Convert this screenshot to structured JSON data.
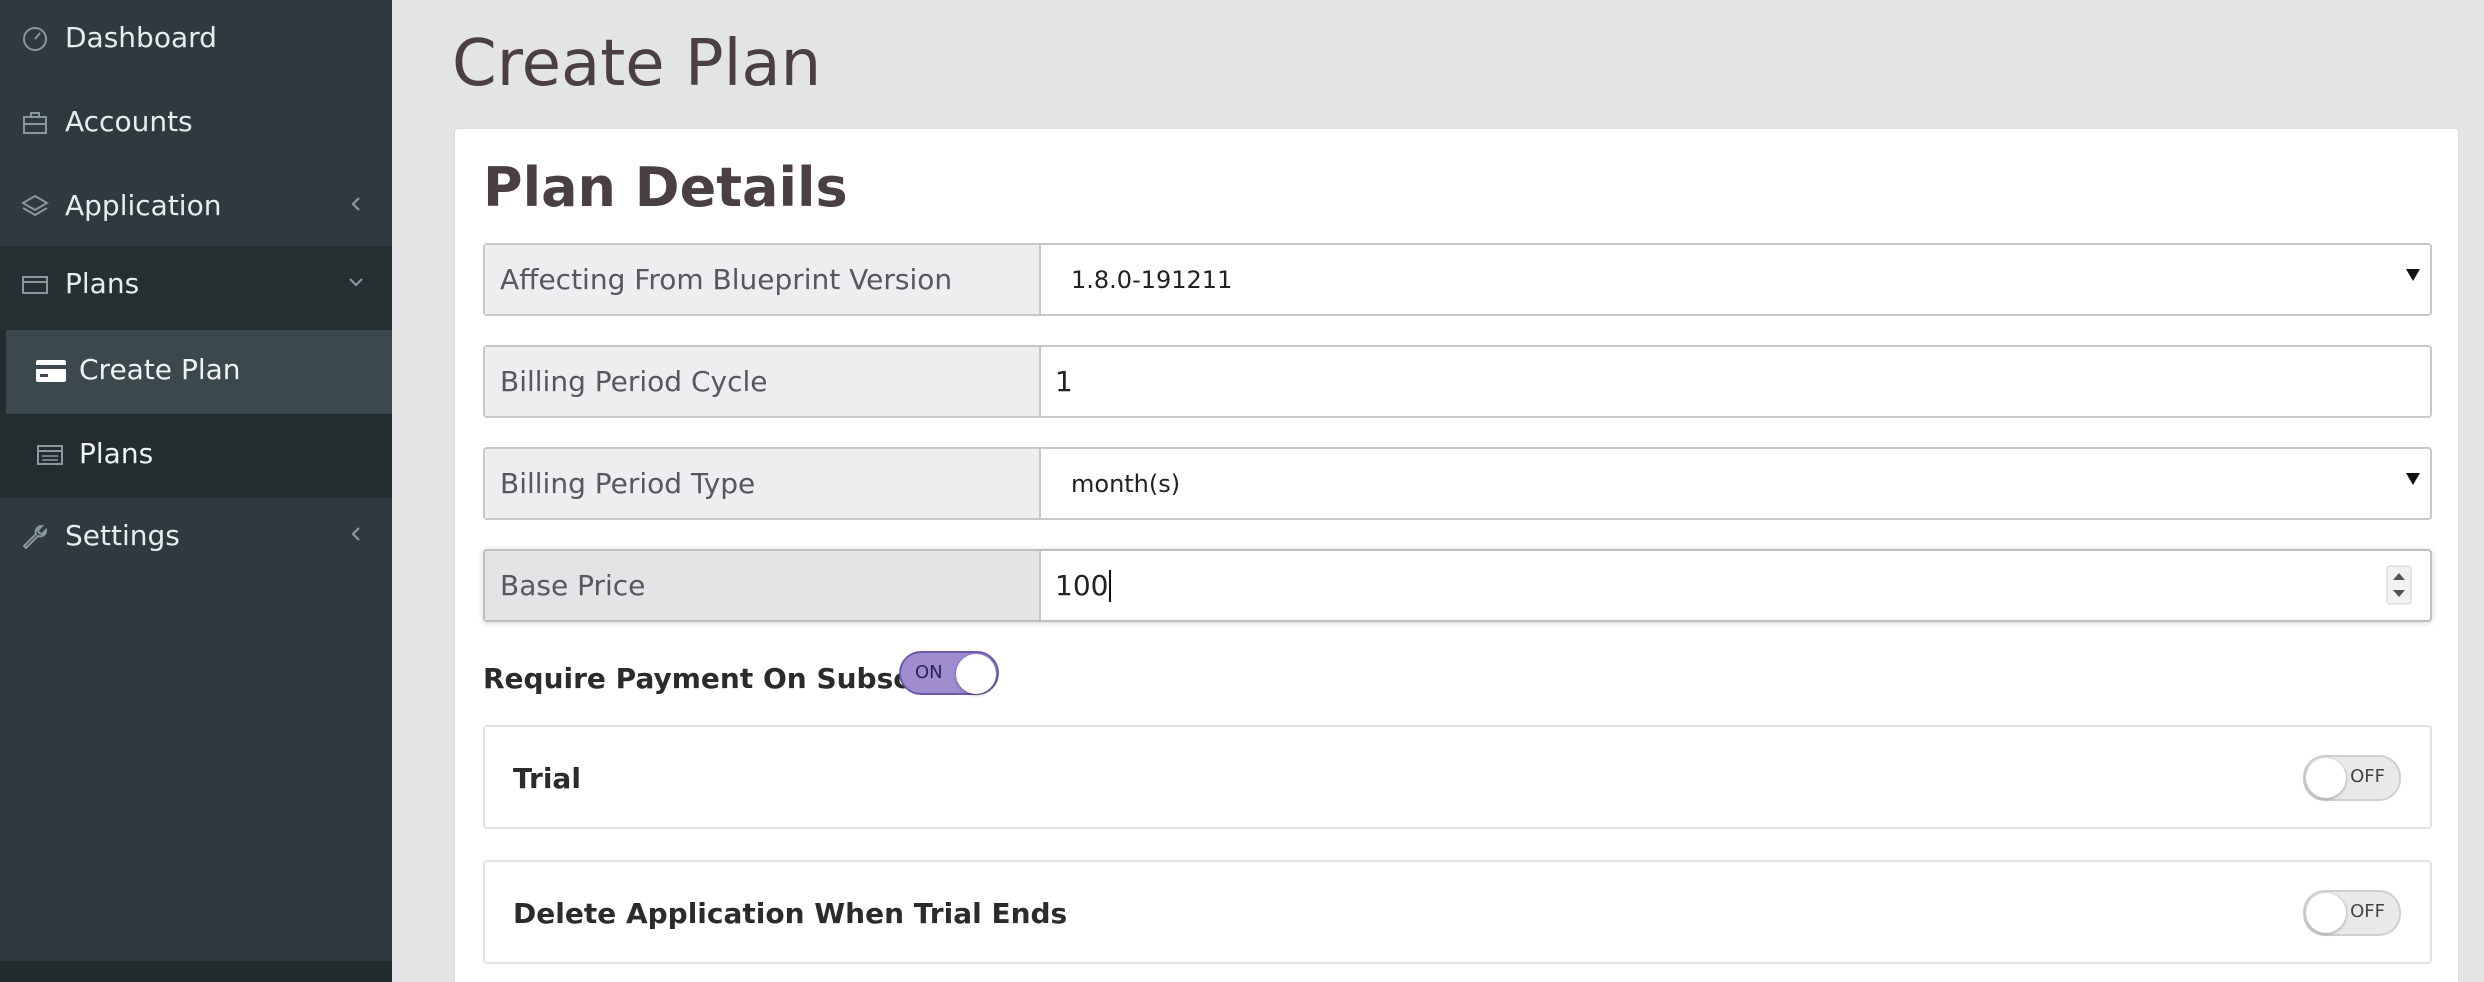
{
  "sidebar": {
    "items": [
      {
        "label": "Dashboard",
        "icon": "dashboard-icon"
      },
      {
        "label": "Accounts",
        "icon": "briefcase-icon"
      },
      {
        "label": "Application",
        "icon": "layers-icon"
      },
      {
        "label": "Plans",
        "icon": "credit-card-icon"
      },
      {
        "label": "Settings",
        "icon": "wrench-icon"
      }
    ],
    "subitems": [
      {
        "label": "Create Plan",
        "icon": "credit-card-icon"
      },
      {
        "label": "Plans",
        "icon": "list-icon"
      }
    ]
  },
  "main": {
    "title": "Create Plan",
    "card_title": "Plan Details",
    "fields": [
      {
        "label": "Affecting From Blueprint Version",
        "value": "1.8.0-191211"
      },
      {
        "label": "Billing Period Cycle",
        "value": "1"
      },
      {
        "label": "Billing Period Type",
        "value": "month(s)"
      },
      {
        "label": "Base Price",
        "value": "100"
      }
    ],
    "require_payment": {
      "label": "Require Payment On Subscribe",
      "state": "ON"
    },
    "trial": {
      "label": "Trial",
      "state": "OFF"
    },
    "delete_app": {
      "label": "Delete Application When Trial Ends",
      "state": "OFF"
    }
  },
  "colors": {
    "sidebar_bg": "#2e3a3e",
    "toggle_on": "#9f8dcf",
    "page_bg": "#e3e4e6"
  }
}
